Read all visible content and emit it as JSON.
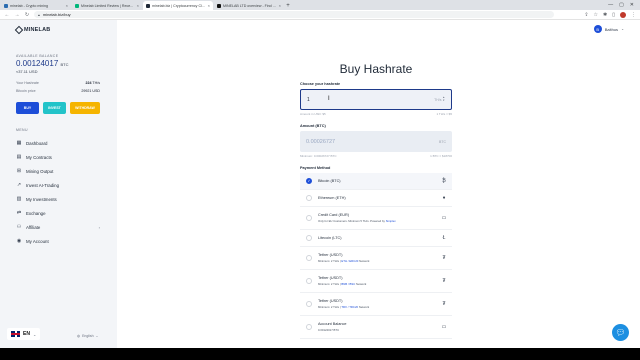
{
  "browser": {
    "tabs": [
      {
        "title": "minelab - Crypto mining",
        "fav": "#2b6cb0",
        "active": false
      },
      {
        "title": "Minelab Limited Review | Rece...",
        "fav": "#00b67a",
        "active": false
      },
      {
        "title": "minelab.biz | Cryptocurrency Cl...",
        "fav": "#1f2937",
        "active": true
      },
      {
        "title": "MINELAB LTD overview - Find a...",
        "fav": "#111111",
        "active": false
      }
    ],
    "url": "minelab.biz/buy"
  },
  "sidebar": {
    "logo_text": "MINELAB",
    "available_balance_label": "AVAILABLE BALANCE",
    "btc_balance": "0.00124017",
    "btc_unit": "BTC",
    "usd_balance": "≈37.11 USD",
    "your_hashrate_label": "Your Hashrate",
    "your_hashrate_value": "224",
    "your_hashrate_unit": "TH/s",
    "bitcoin_price_label": "Bitcoin price",
    "bitcoin_price_value": "29921 USD",
    "buy_label": "BUY",
    "invest_label": "INVEST",
    "withdraw_label": "WITHDRAW",
    "menu_label": "MENU",
    "menu": [
      {
        "label": "Dashboard",
        "icon": "dashboard-icon",
        "glyph": "▦"
      },
      {
        "label": "My Contracts",
        "icon": "contracts-icon",
        "glyph": "▤"
      },
      {
        "label": "Mining Output",
        "icon": "mining-output-icon",
        "glyph": "⊞"
      },
      {
        "label": "Invest AI-Trading",
        "icon": "trading-icon",
        "glyph": "↗"
      },
      {
        "label": "My Investments",
        "icon": "investments-icon",
        "glyph": "▥"
      },
      {
        "label": "Exchange",
        "icon": "exchange-icon",
        "glyph": "⇄"
      },
      {
        "label": "Affiliate",
        "icon": "affiliate-icon",
        "glyph": "⚇",
        "chevron": "›"
      },
      {
        "label": "My Account",
        "icon": "account-icon",
        "glyph": "◉"
      }
    ],
    "lang_code": "EN",
    "lang_select": "English"
  },
  "header": {
    "user_name": "Balthus",
    "user_initial": "B"
  },
  "main": {
    "title": "Buy Hashrate",
    "choose_label": "Choose your hashrate",
    "hashrate_value": "1",
    "hashrate_unit": "TH/s",
    "amount_usd_hint": "Amount in USD: $5",
    "rate_hint": "1 TH/s = $5",
    "amount_btc_label": "Amount (BTC)",
    "amount_btc_value": "0.00026727",
    "amount_btc_unit": "BTC",
    "min_hint": "Minimum: 0.00026727 BTC",
    "btc_rate_hint": "1 BTC = $18700",
    "payment_label": "Payment Method",
    "methods": [
      {
        "name": "Bitcoin (BTC)",
        "sub": "",
        "link": "",
        "sub_tail": "",
        "glyph": "₿",
        "icon": "bitcoin-icon",
        "selected": true
      },
      {
        "name": "Ethereum (ETH)",
        "sub": "",
        "link": "",
        "sub_tail": "",
        "glyph": "♦",
        "icon": "ethereum-icon",
        "selected": false
      },
      {
        "name": "Credit Card (EUR)",
        "sub": "Only for EU Customers. Minimum 5 TH/s. Powered by ",
        "link": "Simplex",
        "sub_tail": "",
        "glyph": "▭",
        "icon": "credit-card-icon",
        "selected": false
      },
      {
        "name": "Litecoin (LTC)",
        "sub": "",
        "link": "",
        "sub_tail": "",
        "glyph": "Ł",
        "icon": "litecoin-icon",
        "selected": false
      },
      {
        "name": "Tether (USDT)",
        "sub": "Minimum: 2 TH/s | ",
        "link": "ETH / ERC20",
        "sub_tail": " Network",
        "glyph": "₮",
        "icon": "tether-icon",
        "selected": false
      },
      {
        "name": "Tether (USDT)",
        "sub": "Minimum: 2 TH/s | ",
        "link": "BNB / BSC",
        "sub_tail": " Network",
        "glyph": "₮",
        "icon": "tether-icon",
        "selected": false
      },
      {
        "name": "Tether (USDT)",
        "sub": "Minimum: 2 TH/s | ",
        "link": "TRX / TRC20",
        "sub_tail": " Network",
        "glyph": "₮",
        "icon": "tether-icon",
        "selected": false
      },
      {
        "name": "Account Balance",
        "sub": "0.00124017 BTC",
        "link": "",
        "sub_tail": "",
        "glyph": "▭",
        "icon": "wallet-icon",
        "selected": false
      }
    ]
  }
}
